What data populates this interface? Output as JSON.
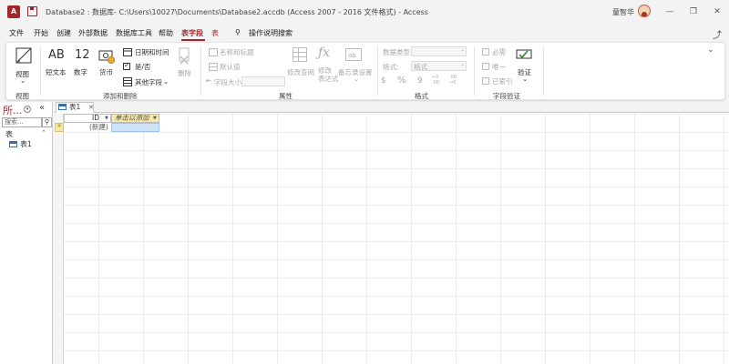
{
  "title_bar": {
    "app_icon_label": "A",
    "window_title": "Database2 : 数据库- C:\\Users\\10027\\Documents\\Database2.accdb (Access 2007 - 2016 文件格式) - Access",
    "user_name": "童智华",
    "minimize": "—",
    "restore": "❐",
    "close": "✕"
  },
  "menu": {
    "items": [
      {
        "label": "文件"
      },
      {
        "label": "开始"
      },
      {
        "label": "创建"
      },
      {
        "label": "外部数据"
      },
      {
        "label": "数据库工具"
      },
      {
        "label": "帮助"
      },
      {
        "label": "表字段"
      },
      {
        "label": "表"
      }
    ],
    "active_index": 6,
    "search_label": "操作说明搜索",
    "search_icon": "lightbulb-icon",
    "share_icon": "share-icon"
  },
  "ribbon": {
    "views": {
      "button_label": "视图",
      "dropdown": "⌄",
      "group_label": "视图"
    },
    "add_delete": {
      "short_text": "短文本",
      "short_text_glyph": "AB",
      "number": "数字",
      "number_glyph": "12",
      "currency": "货币",
      "date_time": "日期和时间",
      "yes_no": "是/否",
      "more_fields": "其他字段",
      "delete": "删除",
      "group_label": "添加和删除"
    },
    "properties": {
      "name_caption": "名称和标题",
      "default_value": "默认值",
      "field_size_label": "字段大小",
      "modify_lookups": "修改查阅",
      "modify_expression": "修改\n表达式",
      "memo_settings": "备忘录设置",
      "group_label": "属性"
    },
    "formatting": {
      "data_type_label": "数据类型:",
      "format_label": "格式:",
      "format_value": "格式",
      "currency_symbol": "$",
      "percent_symbol": "%",
      "comma_symbol": "9",
      "increase_decimals": "←0\n.00",
      "decrease_decimals": ".00\n→0",
      "group_label": "格式"
    },
    "validation": {
      "required": "必需",
      "unique": "唯一",
      "indexed": "已索引",
      "validation_button": "验证",
      "group_label": "字段验证"
    },
    "collapse": "⌄"
  },
  "nav_pane": {
    "title": "所...",
    "search_placeholder": "搜索...",
    "group": "表",
    "items": [
      {
        "label": "表1"
      }
    ]
  },
  "document": {
    "tab_label": "表1",
    "columns": [
      {
        "header": "ID"
      },
      {
        "header": "单击以添加"
      }
    ],
    "new_row_label": "(新建)",
    "new_row_marker": "*"
  },
  "colors": {
    "accent": "#a4262c",
    "header_highlight": "#f9e7a7",
    "selected_cell": "#cfe3f7"
  }
}
